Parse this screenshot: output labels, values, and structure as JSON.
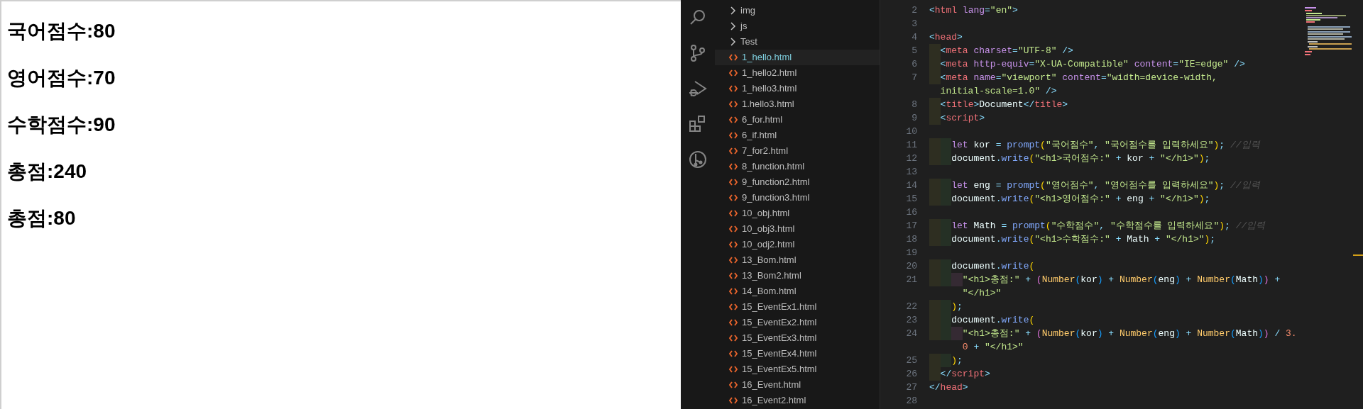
{
  "browser": {
    "headings": [
      "국어점수:80",
      "영어점수:70",
      "수학점수:90",
      "총점:240",
      "총점:80"
    ]
  },
  "explorer": {
    "items": [
      {
        "kind": "folder",
        "name": "img",
        "selected": false
      },
      {
        "kind": "folder",
        "name": "js",
        "selected": false
      },
      {
        "kind": "folder",
        "name": "Test",
        "selected": false
      },
      {
        "kind": "file",
        "name": "1_hello.html",
        "selected": true
      },
      {
        "kind": "file",
        "name": "1_hello2.html",
        "selected": false
      },
      {
        "kind": "file",
        "name": "1_hello3.html",
        "selected": false
      },
      {
        "kind": "file",
        "name": "1.hello3.html",
        "selected": false
      },
      {
        "kind": "file",
        "name": "6_for.html",
        "selected": false
      },
      {
        "kind": "file",
        "name": "6_if.html",
        "selected": false
      },
      {
        "kind": "file",
        "name": "7_for2.html",
        "selected": false
      },
      {
        "kind": "file",
        "name": "8_function.html",
        "selected": false
      },
      {
        "kind": "file",
        "name": "9_function2.html",
        "selected": false
      },
      {
        "kind": "file",
        "name": "9_function3.html",
        "selected": false
      },
      {
        "kind": "file",
        "name": "10_obj.html",
        "selected": false
      },
      {
        "kind": "file",
        "name": "10_obj3.html",
        "selected": false
      },
      {
        "kind": "file",
        "name": "10_odj2.html",
        "selected": false
      },
      {
        "kind": "file",
        "name": "13_Bom.html",
        "selected": false
      },
      {
        "kind": "file",
        "name": "13_Bom2.html",
        "selected": false
      },
      {
        "kind": "file",
        "name": "14_Bom.html",
        "selected": false
      },
      {
        "kind": "file",
        "name": "15_EventEx1.html",
        "selected": false
      },
      {
        "kind": "file",
        "name": "15_EventEx2.html",
        "selected": false
      },
      {
        "kind": "file",
        "name": "15_EventEx3.html",
        "selected": false
      },
      {
        "kind": "file",
        "name": "15_EventEx4.html",
        "selected": false
      },
      {
        "kind": "file",
        "name": "15_EventEx5.html",
        "selected": false
      },
      {
        "kind": "file",
        "name": "16_Event.html",
        "selected": false
      },
      {
        "kind": "file",
        "name": "16_Event2.html",
        "selected": false
      }
    ]
  },
  "editor": {
    "lines": [
      {
        "number": "2",
        "rows": [
          {
            "tokens": [
              {
                "kind": "punct",
                "text": "<"
              },
              {
                "kind": "tag",
                "text": "html"
              },
              {
                "kind": "attr",
                "text": " lang"
              },
              {
                "kind": "punct",
                "text": "="
              },
              {
                "kind": "str",
                "text": "\"en\""
              },
              {
                "kind": "punct",
                "text": ">"
              }
            ]
          }
        ]
      },
      {
        "number": "3"
      },
      {
        "number": "4",
        "rows": [
          {
            "tokens": [
              {
                "kind": "punct",
                "text": "<"
              },
              {
                "kind": "tag",
                "text": "head"
              },
              {
                "kind": "punct",
                "text": ">"
              }
            ]
          }
        ]
      },
      {
        "number": "5",
        "rows": [
          {
            "tokens": [
              {
                "kind": "punct",
                "text": "  <"
              },
              {
                "kind": "tag",
                "text": "meta"
              },
              {
                "kind": "attr",
                "text": " charset"
              },
              {
                "kind": "punct",
                "text": "="
              },
              {
                "kind": "str",
                "text": "\"UTF-8\""
              },
              {
                "kind": "punct",
                "text": " />"
              }
            ]
          }
        ]
      },
      {
        "number": "6",
        "rows": [
          {
            "tokens": [
              {
                "kind": "punct",
                "text": "  <"
              },
              {
                "kind": "tag",
                "text": "meta"
              },
              {
                "kind": "attr",
                "text": " http-equiv"
              },
              {
                "kind": "punct",
                "text": "="
              },
              {
                "kind": "str",
                "text": "\"X-UA-Compatible\""
              },
              {
                "kind": "attr",
                "text": " content"
              },
              {
                "kind": "punct",
                "text": "="
              },
              {
                "kind": "str",
                "text": "\"IE=edge\""
              },
              {
                "kind": "punct",
                "text": " />"
              }
            ]
          }
        ]
      },
      {
        "number": "7",
        "rows": [
          {
            "tokens": [
              {
                "kind": "punct",
                "text": "  <"
              },
              {
                "kind": "tag",
                "text": "meta"
              },
              {
                "kind": "attr",
                "text": " name"
              },
              {
                "kind": "punct",
                "text": "="
              },
              {
                "kind": "str",
                "text": "\"viewport\""
              },
              {
                "kind": "attr",
                "text": " content"
              },
              {
                "kind": "punct",
                "text": "="
              },
              {
                "kind": "str",
                "text": "\"width=device-width,"
              }
            ]
          },
          {
            "tokens": [
              {
                "kind": "str",
                "text": "  initial-scale=1.0\""
              },
              {
                "kind": "punct",
                "text": " />"
              }
            ]
          }
        ]
      },
      {
        "number": "8",
        "rows": [
          {
            "tokens": [
              {
                "kind": "punct",
                "text": "  <"
              },
              {
                "kind": "tag",
                "text": "title"
              },
              {
                "kind": "punct",
                "text": ">"
              },
              {
                "kind": "text",
                "text": "Document"
              },
              {
                "kind": "punct",
                "text": "</"
              },
              {
                "kind": "tag",
                "text": "title"
              },
              {
                "kind": "punct",
                "text": ">"
              }
            ]
          }
        ]
      },
      {
        "number": "9",
        "rows": [
          {
            "tokens": [
              {
                "kind": "punct",
                "text": "  <"
              },
              {
                "kind": "tag",
                "text": "script"
              },
              {
                "kind": "punct",
                "text": ">"
              }
            ]
          }
        ]
      },
      {
        "number": "10"
      },
      {
        "number": "11",
        "rows": [
          {
            "tokens": [
              {
                "kind": "kw",
                "text": "    let"
              },
              {
                "kind": "text",
                "text": " kor "
              },
              {
                "kind": "punct",
                "text": "="
              },
              {
                "kind": "fn",
                "text": " prompt"
              },
              {
                "kind": "p1",
                "text": "("
              },
              {
                "kind": "str",
                "text": "\"국어점수\""
              },
              {
                "kind": "punct",
                "text": ", "
              },
              {
                "kind": "str",
                "text": "\"국어점수를 입력하세요\""
              },
              {
                "kind": "p1",
                "text": ")"
              },
              {
                "kind": "punct",
                "text": ";"
              },
              {
                "kind": "comment",
                "text": " //입력"
              }
            ]
          }
        ]
      },
      {
        "number": "12",
        "rows": [
          {
            "tokens": [
              {
                "kind": "text",
                "text": "    document"
              },
              {
                "kind": "punct",
                "text": "."
              },
              {
                "kind": "fn",
                "text": "write"
              },
              {
                "kind": "p1",
                "text": "("
              },
              {
                "kind": "str",
                "text": "\"<h1>국어점수:\""
              },
              {
                "kind": "punct",
                "text": " + "
              },
              {
                "kind": "text",
                "text": "kor"
              },
              {
                "kind": "punct",
                "text": " + "
              },
              {
                "kind": "str",
                "text": "\"</h1>\""
              },
              {
                "kind": "p1",
                "text": ")"
              },
              {
                "kind": "punct",
                "text": ";"
              }
            ]
          }
        ]
      },
      {
        "number": "13"
      },
      {
        "number": "14",
        "rows": [
          {
            "tokens": [
              {
                "kind": "kw",
                "text": "    let"
              },
              {
                "kind": "text",
                "text": " eng "
              },
              {
                "kind": "punct",
                "text": "="
              },
              {
                "kind": "fn",
                "text": " prompt"
              },
              {
                "kind": "p1",
                "text": "("
              },
              {
                "kind": "str",
                "text": "\"영어점수\""
              },
              {
                "kind": "punct",
                "text": ", "
              },
              {
                "kind": "str",
                "text": "\"영어점수를 입력하세요\""
              },
              {
                "kind": "p1",
                "text": ")"
              },
              {
                "kind": "punct",
                "text": ";"
              },
              {
                "kind": "comment",
                "text": " //입력"
              }
            ]
          }
        ]
      },
      {
        "number": "15",
        "rows": [
          {
            "tokens": [
              {
                "kind": "text",
                "text": "    document"
              },
              {
                "kind": "punct",
                "text": "."
              },
              {
                "kind": "fn",
                "text": "write"
              },
              {
                "kind": "p1",
                "text": "("
              },
              {
                "kind": "str",
                "text": "\"<h1>영어점수:\""
              },
              {
                "kind": "punct",
                "text": " + "
              },
              {
                "kind": "text",
                "text": "eng"
              },
              {
                "kind": "punct",
                "text": " + "
              },
              {
                "kind": "str",
                "text": "\"</h1>\""
              },
              {
                "kind": "p1",
                "text": ")"
              },
              {
                "kind": "punct",
                "text": ";"
              }
            ]
          }
        ]
      },
      {
        "number": "16"
      },
      {
        "number": "17",
        "rows": [
          {
            "tokens": [
              {
                "kind": "kw",
                "text": "    let"
              },
              {
                "kind": "text",
                "text": " Math "
              },
              {
                "kind": "punct",
                "text": "="
              },
              {
                "kind": "fn",
                "text": " prompt"
              },
              {
                "kind": "p1",
                "text": "("
              },
              {
                "kind": "str",
                "text": "\"수학점수\""
              },
              {
                "kind": "punct",
                "text": ", "
              },
              {
                "kind": "str",
                "text": "\"수학점수를 입력하세요\""
              },
              {
                "kind": "p1",
                "text": ")"
              },
              {
                "kind": "punct",
                "text": ";"
              },
              {
                "kind": "comment",
                "text": " //입력"
              }
            ]
          }
        ]
      },
      {
        "number": "18",
        "rows": [
          {
            "tokens": [
              {
                "kind": "text",
                "text": "    document"
              },
              {
                "kind": "punct",
                "text": "."
              },
              {
                "kind": "fn",
                "text": "write"
              },
              {
                "kind": "p1",
                "text": "("
              },
              {
                "kind": "str",
                "text": "\"<h1>수학점수:\""
              },
              {
                "kind": "punct",
                "text": " + "
              },
              {
                "kind": "text",
                "text": "Math"
              },
              {
                "kind": "punct",
                "text": " + "
              },
              {
                "kind": "str",
                "text": "\"</h1>\""
              },
              {
                "kind": "p1",
                "text": ")"
              },
              {
                "kind": "punct",
                "text": ";"
              }
            ]
          }
        ]
      },
      {
        "number": "19"
      },
      {
        "number": "20",
        "rows": [
          {
            "tokens": [
              {
                "kind": "text",
                "text": "    document"
              },
              {
                "kind": "punct",
                "text": "."
              },
              {
                "kind": "fn",
                "text": "write"
              },
              {
                "kind": "p1",
                "text": "("
              }
            ]
          }
        ]
      },
      {
        "number": "21",
        "rows": [
          {
            "tokens": [
              {
                "kind": "str",
                "text": "      \"<h1>총점:\""
              },
              {
                "kind": "punct",
                "text": " + "
              },
              {
                "kind": "p2",
                "text": "("
              },
              {
                "kind": "type",
                "text": "Number"
              },
              {
                "kind": "p3",
                "text": "("
              },
              {
                "kind": "text",
                "text": "kor"
              },
              {
                "kind": "p3",
                "text": ")"
              },
              {
                "kind": "punct",
                "text": " + "
              },
              {
                "kind": "type",
                "text": "Number"
              },
              {
                "kind": "p3",
                "text": "("
              },
              {
                "kind": "text",
                "text": "eng"
              },
              {
                "kind": "p3",
                "text": ")"
              },
              {
                "kind": "punct",
                "text": " + "
              },
              {
                "kind": "type",
                "text": "Number"
              },
              {
                "kind": "p3",
                "text": "("
              },
              {
                "kind": "text",
                "text": "Math"
              },
              {
                "kind": "p3",
                "text": ")"
              },
              {
                "kind": "p2",
                "text": ")"
              },
              {
                "kind": "punct",
                "text": " +"
              }
            ]
          },
          {
            "tokens": [
              {
                "kind": "str",
                "text": "      \"</h1>\""
              }
            ]
          }
        ]
      },
      {
        "number": "22",
        "rows": [
          {
            "tokens": [
              {
                "kind": "p1",
                "text": "    )"
              },
              {
                "kind": "punct",
                "text": ";"
              }
            ]
          }
        ]
      },
      {
        "number": "23",
        "rows": [
          {
            "tokens": [
              {
                "kind": "text",
                "text": "    document"
              },
              {
                "kind": "punct",
                "text": "."
              },
              {
                "kind": "fn",
                "text": "write"
              },
              {
                "kind": "p1",
                "text": "("
              }
            ]
          }
        ]
      },
      {
        "number": "24",
        "rows": [
          {
            "tokens": [
              {
                "kind": "str",
                "text": "      \"<h1>총점:\""
              },
              {
                "kind": "punct",
                "text": " + "
              },
              {
                "kind": "p2",
                "text": "("
              },
              {
                "kind": "type",
                "text": "Number"
              },
              {
                "kind": "p3",
                "text": "("
              },
              {
                "kind": "text",
                "text": "kor"
              },
              {
                "kind": "p3",
                "text": ")"
              },
              {
                "kind": "punct",
                "text": " + "
              },
              {
                "kind": "type",
                "text": "Number"
              },
              {
                "kind": "p3",
                "text": "("
              },
              {
                "kind": "text",
                "text": "eng"
              },
              {
                "kind": "p3",
                "text": ")"
              },
              {
                "kind": "punct",
                "text": " + "
              },
              {
                "kind": "type",
                "text": "Number"
              },
              {
                "kind": "p3",
                "text": "("
              },
              {
                "kind": "text",
                "text": "Math"
              },
              {
                "kind": "p3",
                "text": ")"
              },
              {
                "kind": "p2",
                "text": ")"
              },
              {
                "kind": "punct",
                "text": " / "
              },
              {
                "kind": "num",
                "text": "3."
              }
            ]
          },
          {
            "tokens": [
              {
                "kind": "num",
                "text": "      0"
              },
              {
                "kind": "punct",
                "text": " + "
              },
              {
                "kind": "str",
                "text": "\"</h1>\""
              }
            ]
          }
        ]
      },
      {
        "number": "25",
        "rows": [
          {
            "tokens": [
              {
                "kind": "p1",
                "text": "    )"
              },
              {
                "kind": "punct",
                "text": ";"
              }
            ]
          }
        ]
      },
      {
        "number": "26",
        "rows": [
          {
            "tokens": [
              {
                "kind": "punct",
                "text": "  </"
              },
              {
                "kind": "tag",
                "text": "script"
              },
              {
                "kind": "punct",
                "text": ">"
              }
            ]
          }
        ]
      },
      {
        "number": "27",
        "rows": [
          {
            "tokens": [
              {
                "kind": "punct",
                "text": "</"
              },
              {
                "kind": "tag",
                "text": "head"
              },
              {
                "kind": "punct",
                "text": ">"
              }
            ]
          }
        ]
      },
      {
        "number": "28"
      }
    ]
  }
}
